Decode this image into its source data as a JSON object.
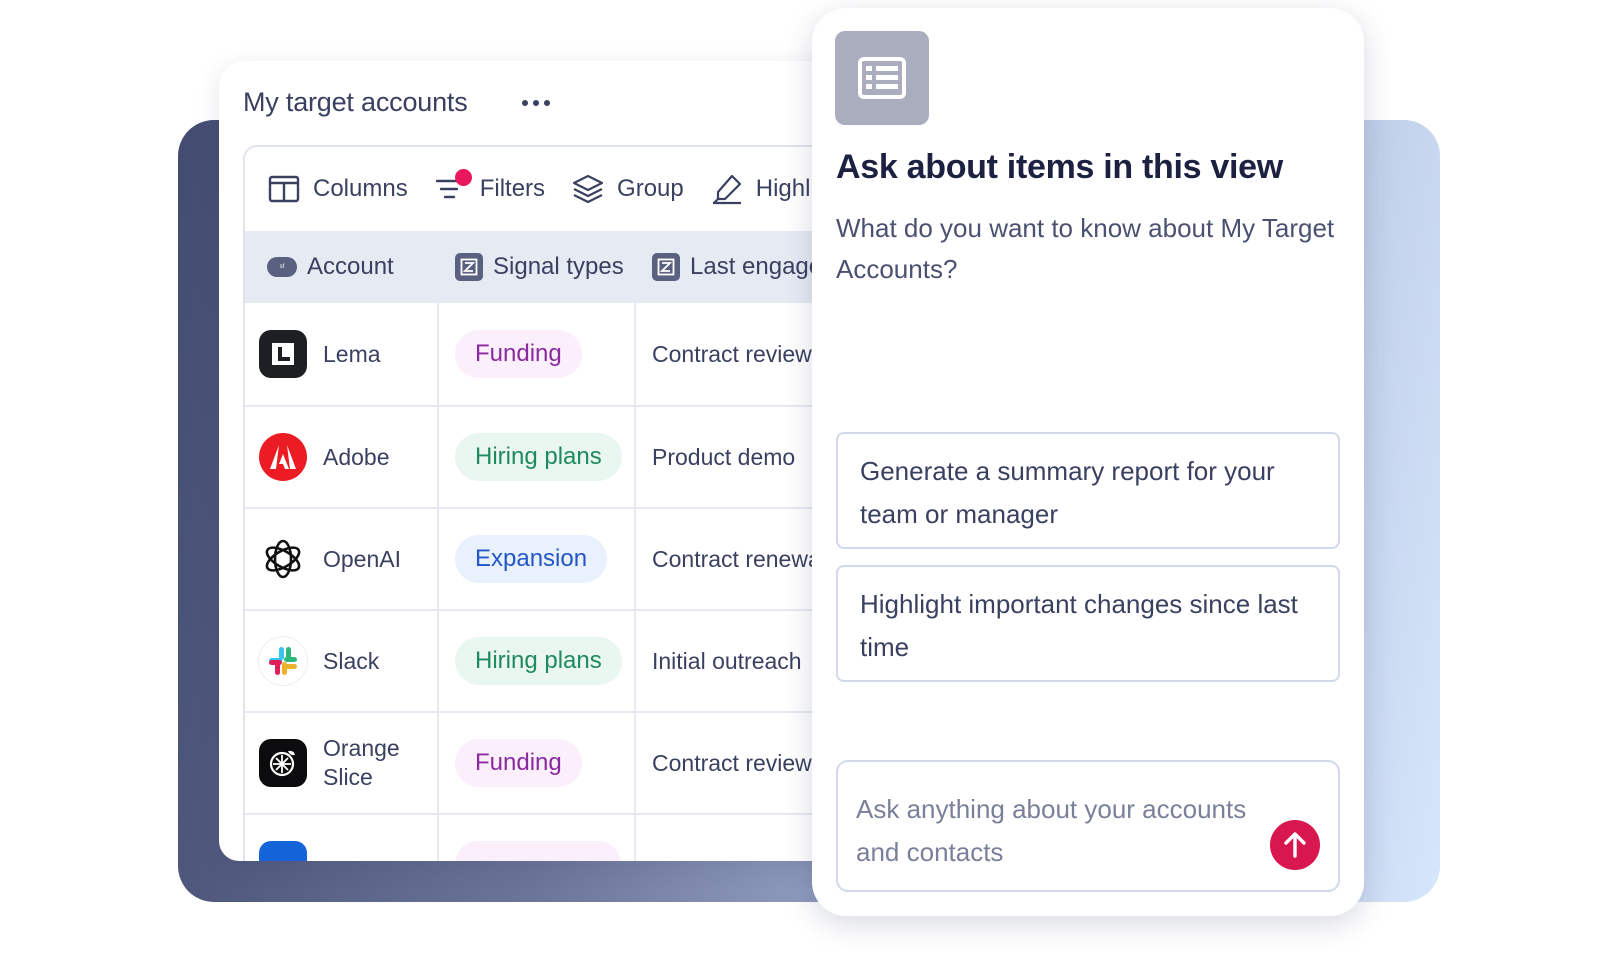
{
  "accounts_card": {
    "title": "My target accounts",
    "toolbar": {
      "columns": "Columns",
      "filters": "Filters",
      "group": "Group",
      "highlight": "Highli"
    },
    "headers": {
      "account": "Account",
      "signal_types": "Signal types",
      "last_engagement": "Last engage"
    },
    "rows": [
      {
        "name": "Lema",
        "signal": "Funding",
        "last": "Contract review"
      },
      {
        "name": "Adobe",
        "signal": "Hiring plans",
        "last": "Product demo"
      },
      {
        "name": "OpenAI",
        "signal": "Expansion",
        "last": "Contract renewa"
      },
      {
        "name": "Slack",
        "signal": "Hiring plans",
        "last": "Initial outreach"
      },
      {
        "name": "Orange Slice",
        "signal": "Funding",
        "last": "Contract review"
      }
    ]
  },
  "ai_panel": {
    "heading": "Ask about items in this view",
    "subtitle": "What do you want to know about My Target Accounts?",
    "suggestions": [
      "Generate a summary report for your team or manager",
      "Highlight important changes since last time"
    ],
    "input_placeholder": "Ask anything about your accounts and contacts"
  },
  "colors": {
    "accent": "#d8174f",
    "funding_bg": "#fbeffb",
    "funding_text": "#8a2aa0",
    "hiring_bg": "#eaf7f1",
    "hiring_text": "#1f8a5e",
    "expansion_bg": "#e9f1fd",
    "expansion_text": "#2456c7"
  },
  "icons": [
    "columns-icon",
    "filter-icon",
    "layers-icon",
    "highlighter-icon",
    "salesforce-icon",
    "signal-icon",
    "table-icon",
    "arrow-up-icon"
  ]
}
